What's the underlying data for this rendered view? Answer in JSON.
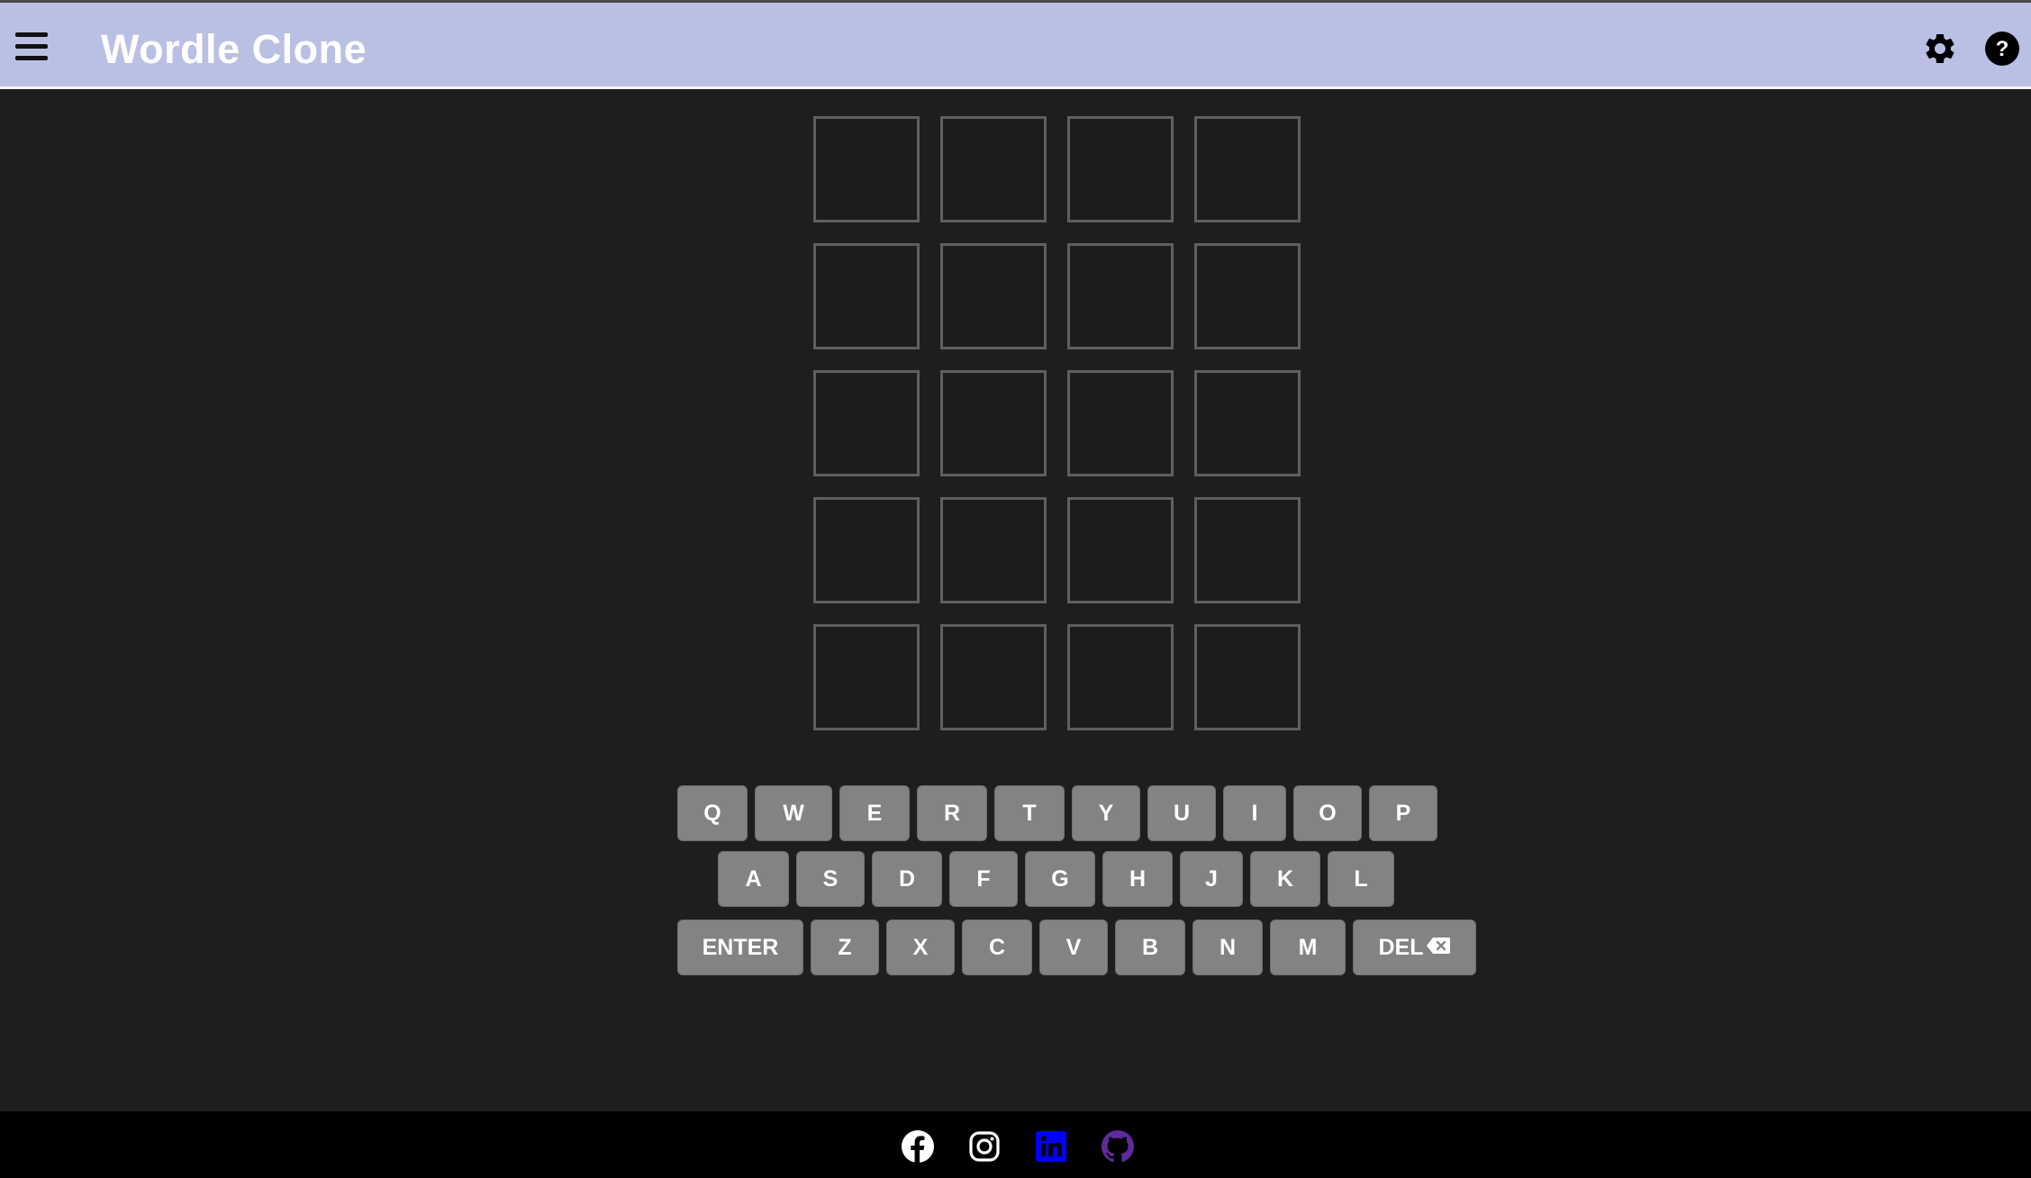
{
  "header": {
    "title": "Wordle Clone",
    "background_color": "#bac0e3",
    "menu_icon": "hamburger-menu-icon",
    "settings_icon": "gear-icon",
    "help_icon": "question-circle-icon"
  },
  "board": {
    "rows": [
      [
        "",
        "",
        "",
        ""
      ],
      [
        "",
        "",
        "",
        ""
      ],
      [
        "",
        "",
        "",
        ""
      ],
      [
        "",
        "",
        "",
        ""
      ],
      [
        "",
        "",
        "",
        ""
      ]
    ],
    "tile_border_color": "#5f5f5f"
  },
  "keyboard": {
    "row1": [
      "Q",
      "W",
      "E",
      "R",
      "T",
      "Y",
      "U",
      "I",
      "O",
      "P"
    ],
    "row2": [
      "A",
      "S",
      "D",
      "F",
      "G",
      "H",
      "J",
      "K",
      "L"
    ],
    "row3": [
      "Z",
      "X",
      "C",
      "V",
      "B",
      "N",
      "M"
    ],
    "enter_label": "ENTER",
    "delete_label": "DEL",
    "delete_icon": "backspace-icon",
    "key_color": "#818384"
  },
  "footer": {
    "social": [
      {
        "name": "facebook",
        "icon": "facebook-icon",
        "color": "#ffffff"
      },
      {
        "name": "instagram",
        "icon": "instagram-icon",
        "color": "#ffffff"
      },
      {
        "name": "linkedin",
        "icon": "linkedin-icon",
        "color": "#0000ff"
      },
      {
        "name": "github",
        "icon": "github-icon",
        "color": "#5e2a9c"
      }
    ]
  }
}
